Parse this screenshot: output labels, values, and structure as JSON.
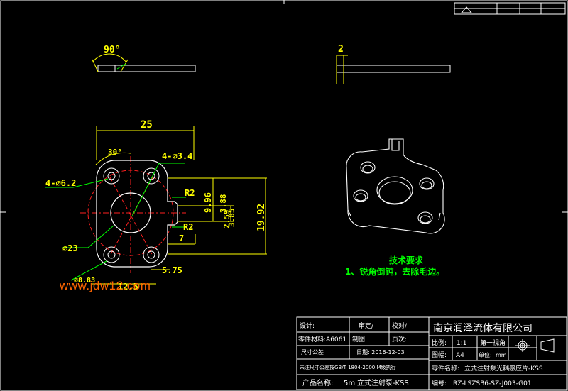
{
  "drawing": {
    "dimensions": {
      "angle_90": "90°",
      "thickness": "2",
      "width_25": "25",
      "angle_30": "30°",
      "holes_3_4": "4-⌀3.4",
      "holes_6_2": "4-⌀6.2",
      "r2_top": "R2",
      "r2_bottom": "R2",
      "dim_9_96": "9.96",
      "dim_3_88": "3.88",
      "dim_3_85": "3.85",
      "dim_2_59": "2.59",
      "dim_19_92": "19.92",
      "dim_7": "7",
      "dia_23": "⌀23",
      "dim_5_75": "5.75",
      "dim_12_5": "12.5",
      "dim_8_83": "⌀8.83"
    },
    "tech_requirements": {
      "title": "技术要求",
      "item1": "1、锐角倒钝，去除毛边。"
    },
    "watermark": "www.jdw12.com"
  },
  "title_block": {
    "designer_label": "设计:",
    "reviewer_label": "审定/",
    "checker_label": "校对/",
    "material_label": "零件材料:A6061",
    "drafter_label": "制图:",
    "pages_label": "页次:",
    "tolerance_label": "尺寸公差",
    "date_label": "日期: 2016-12-03",
    "standard_note": "未注尺寸公差按GB/T 1804-2000 M级执行",
    "product_label": "产品名称:",
    "product_name": "5ml立式注射泵-KSS",
    "company": "南京润泽流体有限公司",
    "scale_label": "比例:",
    "scale_value": "1:1",
    "projection_label": "第一视角",
    "sheet_label": "图幅:",
    "sheet_value": "A4",
    "unit_label": "单位:",
    "unit_value": "mm",
    "part_name_label": "零件名称:",
    "part_name": "立式注射泵光耦感应片-KSS",
    "number_label": "编号:",
    "number_value": "RZ-LSZSB6-SZ-J003-G01"
  },
  "colors": {
    "background": "#000000",
    "outline": "#ffffff",
    "dimension": "#ffff00",
    "centerline": "#ff2020",
    "leader": "#00ff00",
    "watermark": "#ff6600"
  }
}
